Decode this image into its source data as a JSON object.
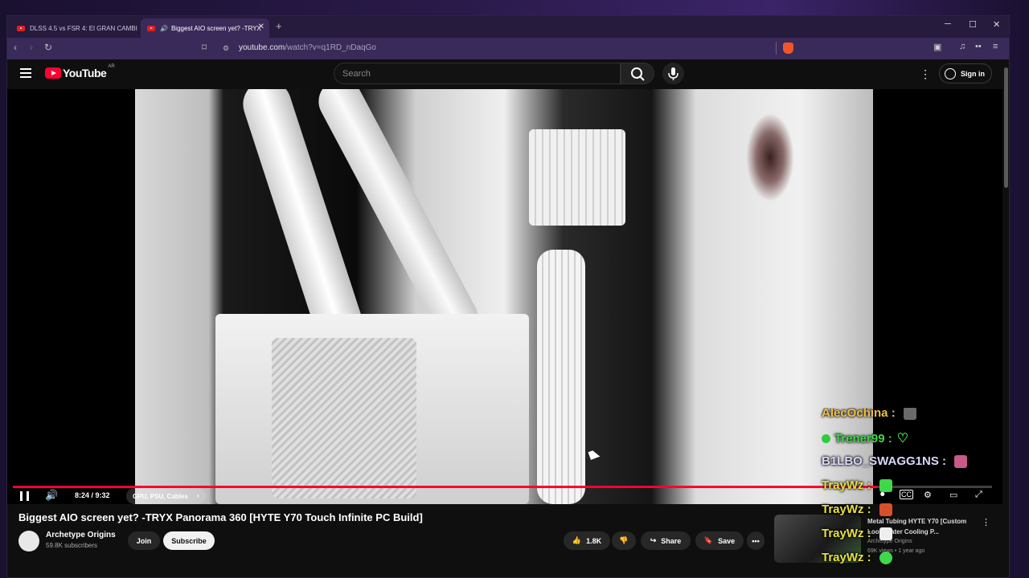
{
  "browser": {
    "tabs": [
      {
        "label": "DLSS 4.5 vs FSR 4: El GRAN CAMBIO",
        "active": false
      },
      {
        "label": "Biggest AIO screen yet? -TRYX",
        "active": true
      }
    ],
    "new_tab": "+",
    "url_host": "youtube.com",
    "url_path": "/watch?v=q1RD_nDaqGo",
    "win_minimize": "─",
    "win_maximize": "☐",
    "win_close": "✕"
  },
  "youtube": {
    "logo_text": "YouTube",
    "country": "AR",
    "search_placeholder": "Search",
    "sign_in": "Sign in"
  },
  "player": {
    "current_time": "8:24",
    "duration": "9:32",
    "time_display": "8:24 / 9:32",
    "progress_fraction": 0.883,
    "chapter": "GPU, PSU, Cables",
    "chapter_chevron": "›"
  },
  "video": {
    "title": "Biggest AIO screen yet? -TRYX Panorama 360 [HYTE Y70 Touch Infinite PC Build]",
    "channel_name": "Archetype Origins",
    "subscribers": "59.8K subscribers",
    "join_label": "Join",
    "subscribe_label": "Subscribe",
    "likes": "1.8K",
    "share_label": "Share",
    "save_label": "Save"
  },
  "up_next": {
    "title": "Metal Tubing HYTE Y70 [Custom Loop Water Cooling P...",
    "channel": "Archetype Origins",
    "meta": "69K views • 1 year ago"
  },
  "chat": [
    {
      "user": "AlecOchina :",
      "emote": "emote-icon"
    },
    {
      "user": "Trener99 :",
      "emote": "heart-icon"
    },
    {
      "user": "B1LBO_SWAGG1NS :",
      "emote": "emote-icon"
    },
    {
      "user": "TrayWz :",
      "emote": "emote-icon"
    },
    {
      "user": "TrayWz :",
      "emote": "emote-icon"
    },
    {
      "user": "TrayWz :",
      "emote": "emote-icon"
    },
    {
      "user": "TrayWz :",
      "emote": "emote-icon"
    }
  ],
  "colors": {
    "accent": "#ff0033",
    "chat_badge": "#2ecc40"
  }
}
